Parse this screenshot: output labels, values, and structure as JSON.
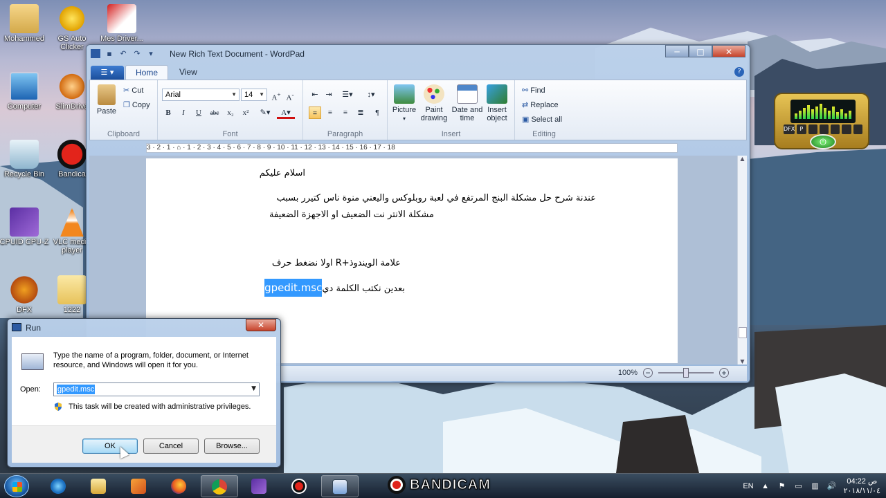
{
  "desktop": {
    "icons": [
      {
        "label": "Mohammed"
      },
      {
        "label": "GS Auto Clicker"
      },
      {
        "label": "Mes Driver..."
      },
      {
        "label": "Computer"
      },
      {
        "label": "SlimDrive"
      },
      {
        "label": "Recycle Bin"
      },
      {
        "label": "Bandica"
      },
      {
        "label": "CPUID CPU-Z"
      },
      {
        "label": "VLC media player"
      },
      {
        "label": "DFX"
      },
      {
        "label": "1222"
      }
    ],
    "widget": {
      "buttons": [
        "DFX",
        "P",
        "",
        "",
        "",
        "",
        ""
      ]
    }
  },
  "wordpad": {
    "title": "New Rich Text Document - WordPad",
    "window_buttons": {
      "minimize": "─",
      "maximize": "□",
      "close": "✕"
    },
    "tabs": [
      "Home",
      "View"
    ],
    "help": "?",
    "clipboard": {
      "paste": "Paste",
      "cut": "Cut",
      "copy": "Copy",
      "label": "Clipboard"
    },
    "font": {
      "family": "Arial",
      "size": "14",
      "label": "Font",
      "bold": "B",
      "italic": "I",
      "underline": "U",
      "strike": "abc",
      "subscript": "x₂",
      "superscript": "x²"
    },
    "paragraph": {
      "label": "Paragraph"
    },
    "insert": {
      "picture": "Picture",
      "paint": "Paint drawing",
      "datetime": "Date and time",
      "object": "Insert object",
      "label": "Insert"
    },
    "editing": {
      "find": "Find",
      "replace": "Replace",
      "select_all": "Select all",
      "label": "Editing"
    },
    "ruler": "3 · 2 · 1 · ⌂ · 1 · 2 · 3 · 4 · 5 · 6 · 7 · 8 · 9 · 10 · 11 · 12 · 13 · 14 · 15 · 16 · 17 · 18",
    "document": {
      "line1": "اسلام عليكم",
      "line2": "عندنة شرح حل مشكلة البنج المرتفع في لعبة روبلوكس واليعني منوة ناس كتيرر بسبب",
      "line3": "مشكلة الانتر نت الضعيف او الاجهزة الضعيفة",
      "line4": "علامة الويندوذ+R اولا نضغط حرف",
      "line5_text": "بعدين نكتب الكلمة دي",
      "line5_selected": "gpedit.msc"
    },
    "status": {
      "zoom": "100%",
      "zoom_level_percent": 100,
      "minus": "−",
      "plus": "+"
    }
  },
  "run_dialog": {
    "title": "Run",
    "close": "✕",
    "description": "Type the name of a program, folder, document, or Internet resource, and Windows will open it for you.",
    "open_label": "Open:",
    "open_value": "gpedit.msc",
    "admin_note": "This task will be created with administrative privileges.",
    "ok": "OK",
    "cancel": "Cancel",
    "browse": "Browse..."
  },
  "taskbar": {
    "bandicam": "BANDICAM",
    "lang": "EN",
    "time": "ص 04:22",
    "date": "٢٠١٨/١١/٠٤"
  }
}
